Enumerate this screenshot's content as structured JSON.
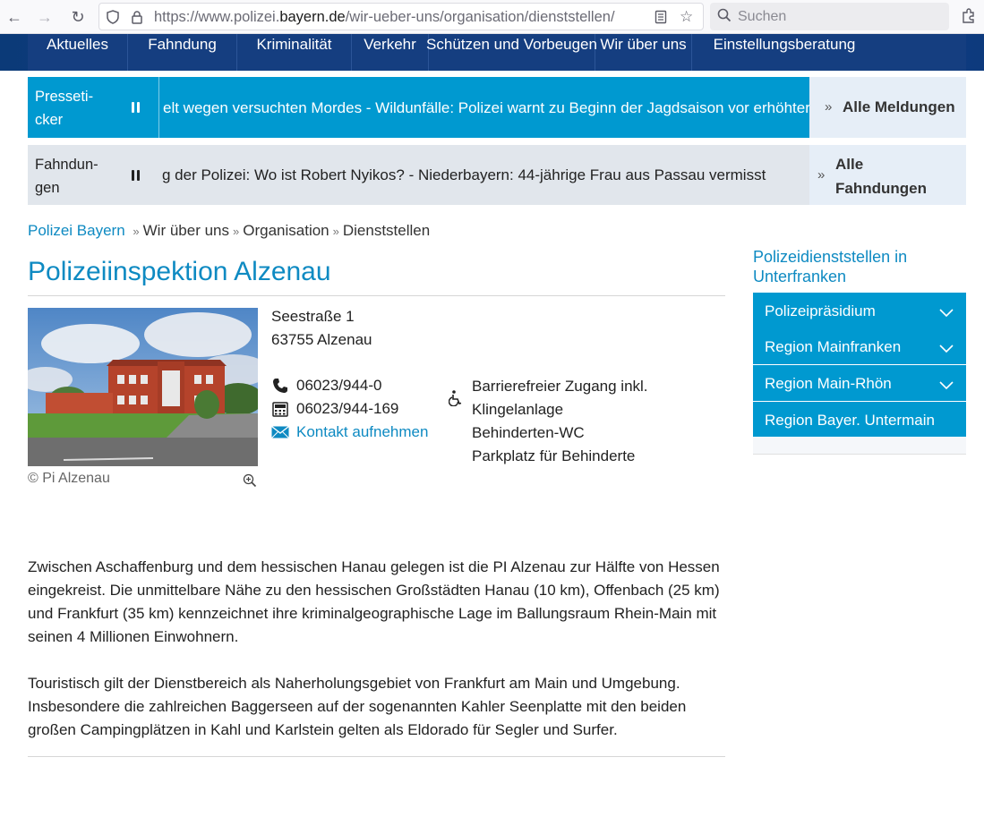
{
  "browser": {
    "url_prefix": "https://www.polizei.",
    "url_domain": "bayern.de",
    "url_path": "/wir-ueber-uns/organisation/dienststellen/",
    "search_placeholder": "Suchen"
  },
  "nav": {
    "items": [
      "Aktuelles",
      "Fahndung",
      "Kriminalität",
      "Verkehr",
      "Schützen und Vorbeugen",
      "Wir über uns",
      "Einstellungsberatung"
    ]
  },
  "press_ticker": {
    "label": "Presseti-\ncker",
    "text": "elt wegen versuchten Mordes   -   Wildunfälle: Polizei warnt zu Beginn der Jagdsaison vor erhöhter Gefahr",
    "all_label": "Alle Meldungen"
  },
  "wanted_ticker": {
    "label": "Fahndun-\ngen",
    "text": "g der Polizei: Wo ist Robert Nyikos?   -   Niederbayern: 44-jährige Frau aus Passau vermisst",
    "all_label": "Alle\nFahndungen"
  },
  "breadcrumb": {
    "home": "Polizei Bayern",
    "items": [
      "Wir über uns",
      "Organisation",
      "Dienststellen"
    ]
  },
  "page": {
    "title": "Polizeiinspektion Alzenau",
    "photo_credit": "© Pi Alzenau",
    "address_street": "Seestraße 1",
    "address_city": "63755 Alzenau",
    "phone": "06023/944-0",
    "fax": "06023/944-169",
    "contact_link": "Kontakt aufnehmen",
    "accessibility": [
      "Barrierefreier Zugang inkl.",
      "Klingelanlage",
      "Behinderten-WC",
      "Parkplatz für Behinderte"
    ],
    "paragraph1": "Zwischen Aschaffenburg und dem hessischen Hanau gelegen ist die PI Alzenau zur Hälfte von Hessen eingekreist. Die unmittelbare Nähe zu den hessischen Großstädten Hanau (10 km), Offenbach (25 km) und Frankfurt (35 km) kennzeichnet ihre kriminalgeographische Lage im Ballungsraum Rhein-Main mit seinen 4 Millionen Einwohnern.",
    "paragraph2": "Touristisch gilt der Dienstbereich als Naherholungsgebiet von Frankfurt am Main und Umgebung. Insbesondere die zahlreichen Baggerseen auf der sogenannten Kahler Seenplatte mit den beiden großen Campingplätzen in Kahl und Karlstein gelten als Eldorado für Segler und Surfer."
  },
  "sidebar": {
    "title": "Polizeidienststellen in Unterfranken",
    "items": [
      "Polizeipräsidium",
      "Region Mainfranken",
      "Region Main-Rhön",
      "Region Bayer. Untermain"
    ]
  },
  "colors": {
    "accent": "#0099d0",
    "link": "#0e8ac2",
    "nav_bg": "#153e80"
  }
}
